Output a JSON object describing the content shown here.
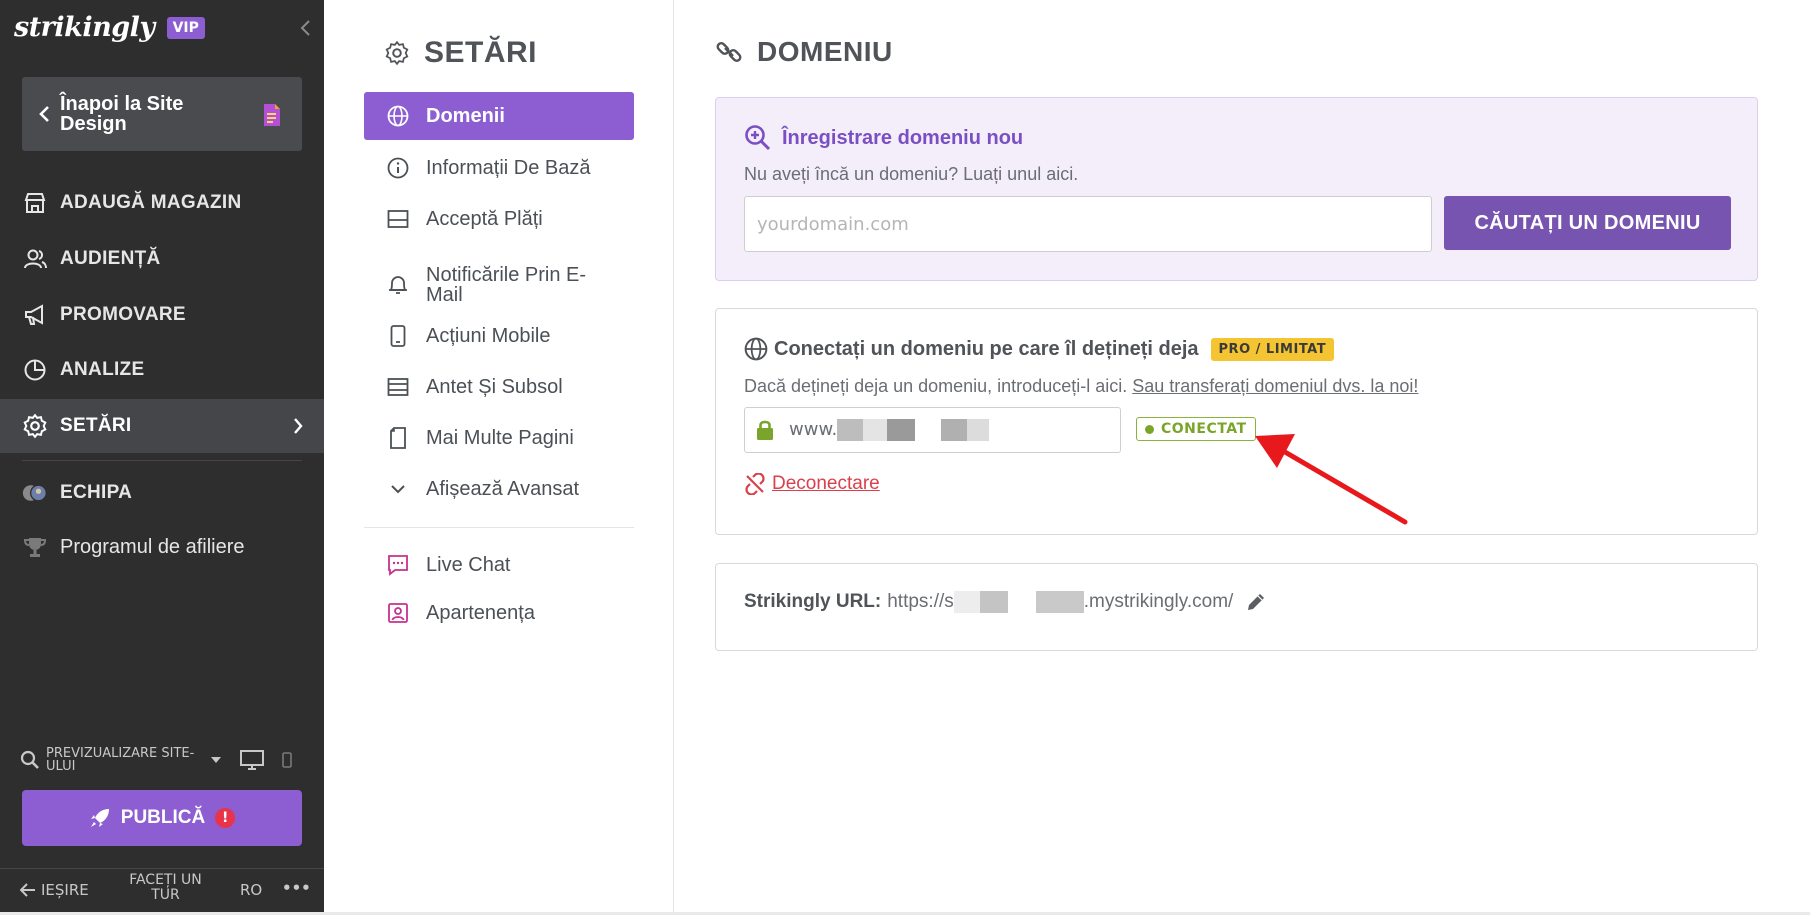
{
  "sidebar": {
    "brand": "strikingly",
    "vip": "VIP",
    "back_label": "Înapoi la Site Design",
    "nav": [
      {
        "label": "ADAUGĂ MAGAZIN",
        "icon": "store-icon"
      },
      {
        "label": "AUDIENȚĂ",
        "icon": "users-icon"
      },
      {
        "label": "PROMOVARE",
        "icon": "megaphone-icon"
      },
      {
        "label": "ANALIZE",
        "icon": "pie-chart-icon"
      },
      {
        "label": "SETĂRI",
        "icon": "gear-icon",
        "active": true
      },
      {
        "label": "ECHIPA",
        "icon": "team-avatars-icon"
      },
      {
        "label": "Programul de afiliere",
        "icon": "trophy-icon"
      }
    ],
    "preview_label": "PREVIZUALIZARE SITE-ULUI",
    "publish_label": "PUBLICĂ",
    "publish_alert": "!",
    "footer": {
      "exit": "IEȘIRE",
      "tour": "FACEȚI UN TUR",
      "lang": "RO",
      "more": "•••"
    }
  },
  "settings": {
    "title": "SETĂRI",
    "items": [
      {
        "label": "Domenii",
        "icon": "globe-icon",
        "active": true
      },
      {
        "label": "Informații De Bază",
        "icon": "info-icon"
      },
      {
        "label": "Acceptă Plăți",
        "icon": "card-icon"
      },
      {
        "label": "Notificările Prin E-Mail",
        "icon": "bell-icon"
      },
      {
        "label": "Acțiuni Mobile",
        "icon": "mobile-icon"
      },
      {
        "label": "Antet Și Subsol",
        "icon": "layout-icon"
      },
      {
        "label": "Mai Multe Pagini",
        "icon": "pages-icon"
      },
      {
        "label": "Afișează Avansat",
        "icon": "chevron-down-icon"
      },
      {
        "label": "Live Chat",
        "icon": "chat-icon"
      },
      {
        "label": "Apartenența",
        "icon": "member-icon"
      }
    ]
  },
  "domain": {
    "title": "DOMENIU",
    "register": {
      "title": "Înregistrare domeniu nou",
      "subtitle": "Nu aveți încă un domeniu? Luați unul aici.",
      "placeholder": "yourdomain.com",
      "button": "CĂUTAȚI UN DOMENIU"
    },
    "connect": {
      "title": "Conectați un domeniu pe care îl dețineți deja",
      "badge": "PRO / LIMITAT",
      "subtitle": "Dacă dețineți deja un domeniu, introduceți-l aici.",
      "transfer_link": "Sau transferați domeniul dvs. la noi!",
      "url_prefix": "www.",
      "status": "CONECTAT",
      "disconnect": "Deconectare"
    },
    "strikingly_url": {
      "label": "Strikingly URL:",
      "prefix": "https://s",
      "suffix": ".mystrikingly.com/"
    }
  },
  "colors": {
    "accent": "#8c5ed1",
    "sidebar_bg": "#2e2e2f",
    "connected": "#7aa52a",
    "danger": "#d9404c",
    "badge": "#f5c432"
  }
}
